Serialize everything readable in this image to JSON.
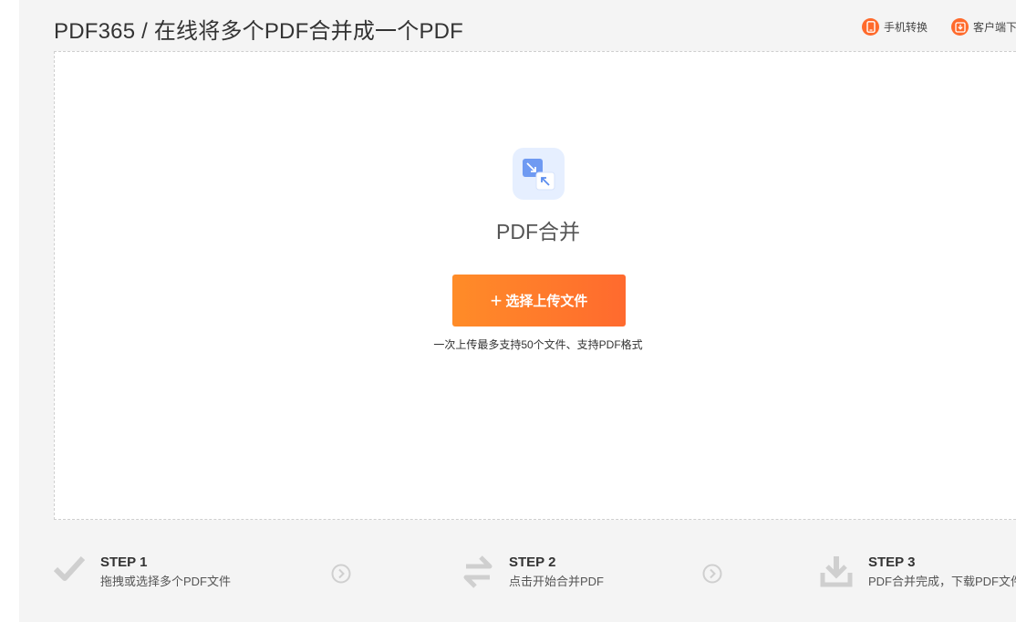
{
  "header": {
    "title": "PDF365 / 在线将多个PDF合并成一个PDF",
    "links": [
      {
        "label": "手机转换",
        "icon": "phone-icon"
      },
      {
        "label": "客户端下载",
        "icon": "download-icon"
      }
    ]
  },
  "upload": {
    "tool_icon": "merge-arrows-icon",
    "tool_name": "PDF合并",
    "button_label": "选择上传文件",
    "hint": "一次上传最多支持50个文件、支持PDF格式"
  },
  "steps": [
    {
      "title": "STEP 1",
      "desc": "拖拽或选择多个PDF文件",
      "icon": "check-icon"
    },
    {
      "title": "STEP 2",
      "desc": "点击开始合并PDF",
      "icon": "swap-icon"
    },
    {
      "title": "STEP 3",
      "desc": "PDF合并完成，下载PDF文件",
      "icon": "download-tray-icon"
    }
  ],
  "colors": {
    "accent": "#ff6a2b",
    "button_start": "#ff8c28",
    "button_end": "#ff6a2e",
    "tool_icon_bg": "#e6efff",
    "tool_icon_fg": "#5b8def"
  }
}
